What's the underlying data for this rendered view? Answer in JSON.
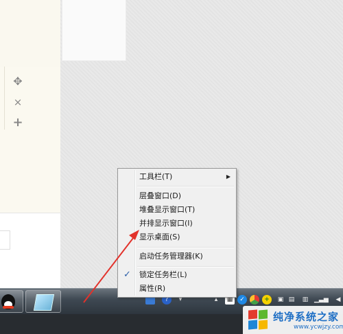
{
  "context_menu": {
    "items": [
      {
        "label": "工具栏(T)",
        "has_submenu": true
      },
      {
        "label": "层叠窗口(D)"
      },
      {
        "label": "堆叠显示窗口(T)"
      },
      {
        "label": "并排显示窗口(I)"
      },
      {
        "label": "显示桌面(S)"
      },
      {
        "label": "启动任务管理器(K)"
      },
      {
        "label": "锁定任务栏(L)",
        "checked": true
      },
      {
        "label": "属性(R)"
      }
    ],
    "check_glyph": "✓",
    "submenu_glyph": "▶"
  },
  "side_toolbar": {
    "move_glyph": "✥",
    "close_glyph": "×",
    "add_glyph": "+"
  },
  "watermark": {
    "title": "纯净系统之家",
    "url": "www.ycwjzy.com"
  },
  "colors": {
    "annotation_arrow": "#e2322b",
    "taskbar": "#3f4953",
    "brand": "#1f6fc5"
  },
  "icons": [
    "qq-icon",
    "app-window-icon",
    "help-icon",
    "wifi-icon",
    "flag-icon",
    "shield-icon",
    "chrome-icon",
    "plus-badge-icon",
    "network-icon",
    "signal-icon",
    "volume-icon"
  ]
}
